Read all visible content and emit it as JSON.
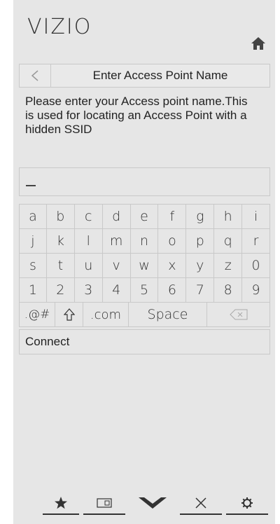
{
  "brand": {
    "logo_text": "VIZIO"
  },
  "header": {
    "title": "Enter Access Point Name"
  },
  "message": {
    "text": "Please enter your Access point name.This is used for locating an Access Point with a hidden SSID"
  },
  "input": {
    "value": ""
  },
  "keyboard": {
    "rows": [
      [
        "a",
        "b",
        "c",
        "d",
        "e",
        "f",
        "g",
        "h",
        "i"
      ],
      [
        "j",
        "k",
        "l",
        "m",
        "n",
        "o",
        "p",
        "q",
        "r"
      ],
      [
        "s",
        "t",
        "u",
        "v",
        "w",
        "x",
        "y",
        "z",
        "0"
      ],
      [
        "1",
        "2",
        "3",
        "4",
        "5",
        "6",
        "7",
        "8",
        "9"
      ]
    ],
    "special": {
      "symbols": ".@#",
      "com": ".com",
      "space": "Space"
    }
  },
  "actions": {
    "connect_label": "Connect"
  },
  "icons": {
    "home": "home-icon",
    "back": "back-arrow-icon",
    "shift": "shift-arrow-icon",
    "delete": "backspace-icon",
    "favorites": "star-icon",
    "input": "input-icon",
    "menu": "chevron-down-icon",
    "exit": "close-icon",
    "settings": "gear-icon"
  },
  "colors": {
    "panel": "#e6e6e6",
    "border": "#c9c9c9",
    "text": "#222222"
  }
}
